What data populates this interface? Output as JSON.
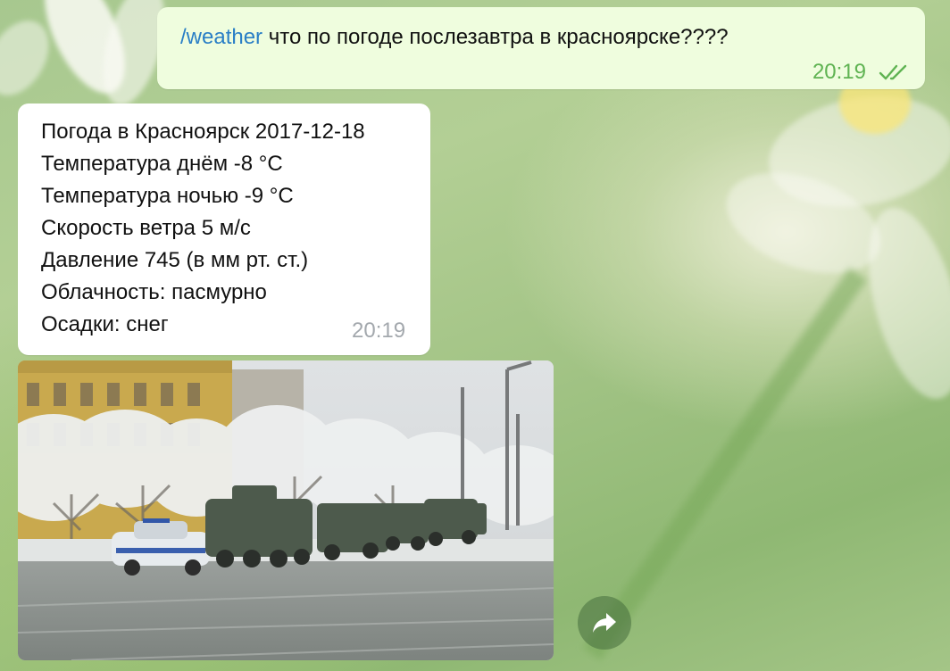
{
  "outgoing_message": {
    "command": "/weather",
    "text": " что по погоде послезавтра в красноярске????",
    "time": "20:19",
    "status_icon": "double-check-icon"
  },
  "incoming_message": {
    "lines": [
      "Погода в Красноярск 2017-12-18",
      "Температура днём -8 °C",
      "Температура ночью -9 °C",
      "Скорость ветра 5 м/с",
      "Давление 745 (в мм рт. ст.)",
      "Облачность: пасмурно",
      "Осадки: снег"
    ],
    "time": "20:19"
  },
  "photo_message": {
    "forward_icon": "forward-arrow-icon"
  },
  "colors": {
    "outgoing_bubble": "#effdde",
    "incoming_bubble": "#ffffff",
    "command_link": "#2a7fc6",
    "outgoing_time": "#5fb352",
    "incoming_time": "#a3a8ad"
  }
}
